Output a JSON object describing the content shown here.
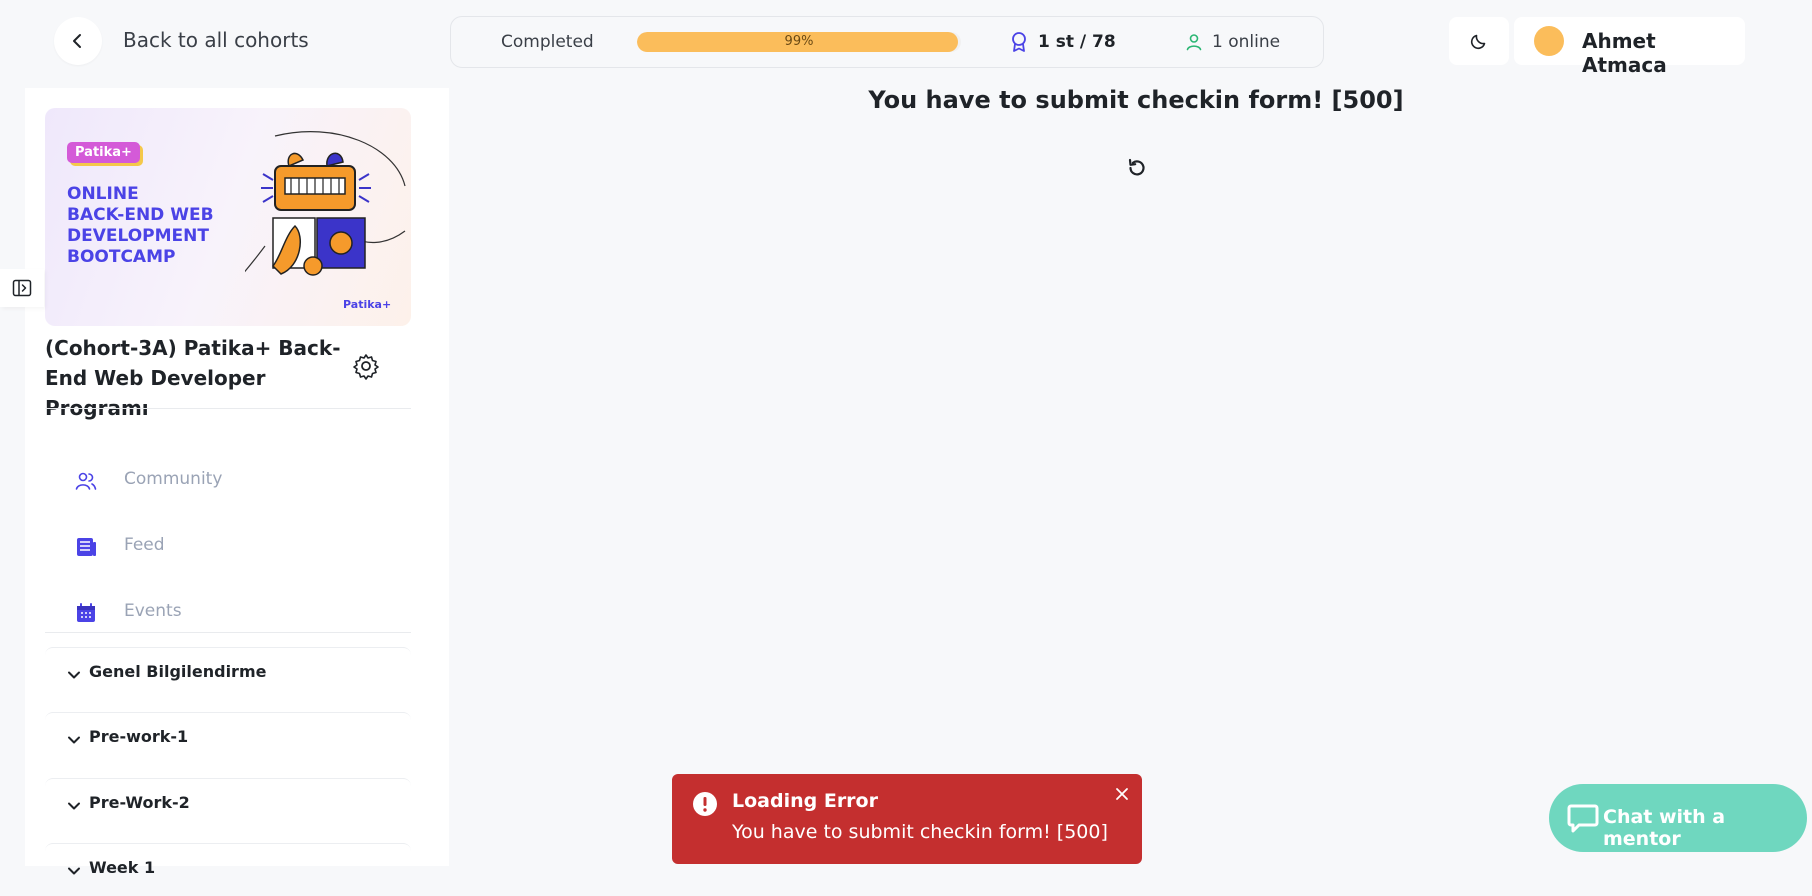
{
  "header": {
    "back_label": "Back to all cohorts",
    "completed_label": "Completed",
    "progress_percent": 99,
    "progress_text": "99%",
    "rank_text": "1 st / 78",
    "online_text": "1 online",
    "user_name": "Ahmet Atmaca"
  },
  "sidebar": {
    "banner": {
      "tag": "Patika+",
      "headline_lines": [
        "ONLINE",
        "BACK-END WEB",
        "DEVELOPMENT",
        "BOOTCAMP"
      ],
      "logo_text": "Patika+"
    },
    "cohort_title": "(Cohort-3A) Patika+ Back-End Web Developer Programı",
    "nav": [
      {
        "label": "Community",
        "icon": "users-icon"
      },
      {
        "label": "Feed",
        "icon": "feed-icon"
      },
      {
        "label": "Events",
        "icon": "calendar-icon"
      }
    ],
    "sections": [
      {
        "label": "Genel Bilgilendirme"
      },
      {
        "label": "Pre-work-1"
      },
      {
        "label": "Pre-Work-2"
      },
      {
        "label": "Week 1"
      }
    ]
  },
  "main": {
    "error_title": "You have to submit checkin form! [500]"
  },
  "toast": {
    "title": "Loading Error",
    "message": "You have to submit checkin form! [500]"
  },
  "chat": {
    "label": "Chat with a mentor"
  },
  "colors": {
    "accent": "#4b43e6",
    "progress": "#fbbd5b",
    "error": "#c42f2f",
    "chat": "#6fd7bf",
    "online": "#2bb673"
  }
}
